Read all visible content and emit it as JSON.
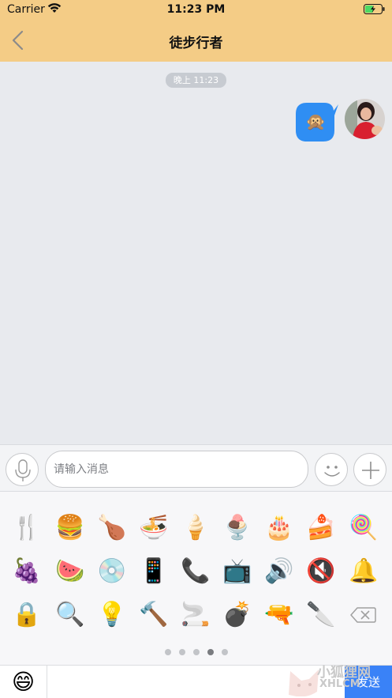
{
  "status_bar": {
    "carrier": "Carrier",
    "time": "11:23 PM"
  },
  "nav": {
    "title": "徒步行者"
  },
  "chat": {
    "timestamp": "晚上 11:23",
    "messages": [
      {
        "from": "me",
        "content": "🙊",
        "type": "emoji"
      }
    ]
  },
  "input": {
    "placeholder": "请输入消息",
    "value": ""
  },
  "emoji_panel": {
    "rows": [
      [
        "🍴",
        "🍔",
        "🍗",
        "🍜",
        "🍦",
        "🍨",
        "🎂",
        "🍰",
        "🍭"
      ],
      [
        "🍇",
        "🍉",
        "💿",
        "📱",
        "📞",
        "📺",
        "🔊",
        "🔇",
        "🔔"
      ],
      [
        "🔒",
        "🔍",
        "💡",
        "🔨",
        "🚬",
        "💣",
        "🔫",
        "🔪"
      ]
    ],
    "page_count": 5,
    "active_page": 4
  },
  "bottom_bar": {
    "face_tab": "😄",
    "send_label": "发送"
  },
  "watermark": {
    "text": "小狐狸网",
    "sub": "XHLCM"
  },
  "colors": {
    "nav_bg": "#f4cc86",
    "bubble": "#2f8ef3",
    "send": "#3a82f7",
    "chat_bg": "#e8eaee"
  }
}
